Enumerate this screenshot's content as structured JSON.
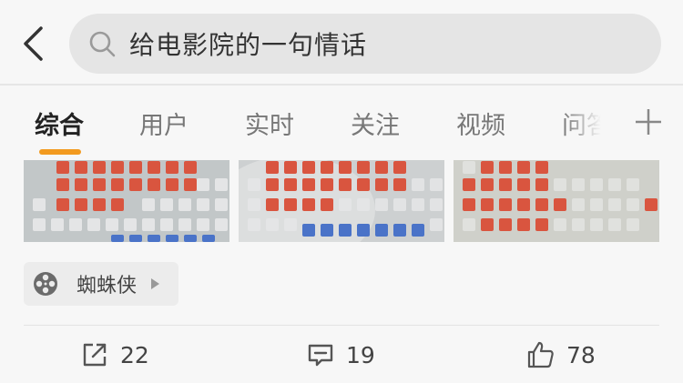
{
  "search": {
    "query": "给电影院的一句情话"
  },
  "tabs": [
    {
      "label": "综合"
    },
    {
      "label": "用户"
    },
    {
      "label": "实时"
    },
    {
      "label": "关注"
    },
    {
      "label": "视频"
    },
    {
      "label": "问答"
    }
  ],
  "accent_color": "#f29a1f",
  "icons": {
    "back": "chevron-left-icon",
    "search": "search-icon",
    "plus": "plus-icon",
    "film": "film-reel-icon",
    "share": "share-icon",
    "comment": "comment-icon",
    "like": "thumbs-up-icon"
  },
  "post": {
    "tag_label": "蜘蛛侠",
    "actions": {
      "share_count": "22",
      "comment_count": "19",
      "like_count": "78"
    }
  }
}
